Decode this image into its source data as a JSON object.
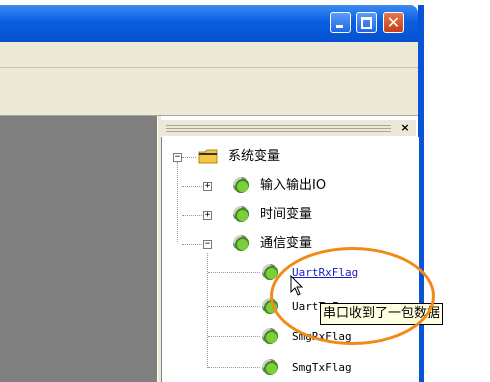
{
  "window": {
    "minimize_icon": "minimize-icon",
    "maximize_icon": "maximize-icon",
    "close_symbol": "✕"
  },
  "panel": {
    "close_symbol": "×",
    "tree": {
      "root": {
        "label": "系统变量",
        "expander": "−",
        "icon": "folder-icon"
      },
      "groups": [
        {
          "label": "输入输出IO",
          "expander": "+",
          "icon": "variable-gear-icon"
        },
        {
          "label": "时间变量",
          "expander": "+",
          "icon": "variable-gear-icon"
        },
        {
          "label": "通信变量",
          "expander": "−",
          "icon": "variable-gear-icon"
        }
      ],
      "comm_items": [
        "UartRxFlag",
        "UartTxF",
        "SmgRxFlag",
        "SmgTxFlag"
      ]
    }
  },
  "tooltip": {
    "text": "串口收到了一包数据"
  },
  "annotation": {
    "color": "#f08a1b"
  }
}
